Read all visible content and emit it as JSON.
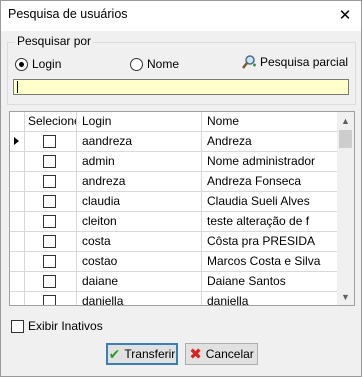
{
  "window": {
    "title": "Pesquisa de usuários"
  },
  "search": {
    "group_label": "Pesquisar por",
    "option_login": "Login",
    "option_name": "Nome",
    "selected_option": "Login",
    "partial_search_label": "Pesquisa parcial",
    "input_value": ""
  },
  "grid": {
    "columns": [
      "Selecione",
      "Login",
      "Nome"
    ],
    "rows": [
      {
        "login": "aandreza",
        "name": "Andreza",
        "checked": false,
        "current": true
      },
      {
        "login": "admin",
        "name": "Nome administrador",
        "checked": false,
        "current": false
      },
      {
        "login": "andreza",
        "name": "Andreza Fonseca",
        "checked": false,
        "current": false
      },
      {
        "login": "claudia",
        "name": "Claudia Sueli  Alves",
        "checked": false,
        "current": false
      },
      {
        "login": "cleiton",
        "name": "teste alteração de f",
        "checked": false,
        "current": false
      },
      {
        "login": "costa",
        "name": "Côsta pra PRESIDA",
        "checked": false,
        "current": false
      },
      {
        "login": "costao",
        "name": "Marcos Costa e Silva",
        "checked": false,
        "current": false
      },
      {
        "login": "daiane",
        "name": "Daiane Santos",
        "checked": false,
        "current": false
      },
      {
        "login": "daniella",
        "name": "daniella",
        "checked": false,
        "current": false
      }
    ]
  },
  "footer": {
    "show_inactive_label": "Exibir Inativos",
    "show_inactive_checked": false,
    "transfer_label": "Transferir",
    "cancel_label": "Cancelar"
  }
}
